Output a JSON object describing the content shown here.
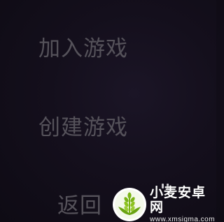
{
  "menu": {
    "join_game": "加入游戏",
    "create_game": "创建游戏",
    "back": "返回"
  },
  "watermark": {
    "brand": "小麦安卓网",
    "url": "www.xmsigma.com",
    "icon": "wheat-logo-icon",
    "accent_color": "#7ab317"
  },
  "colors": {
    "background": "#140f1c",
    "menu_text": "#55525a"
  }
}
